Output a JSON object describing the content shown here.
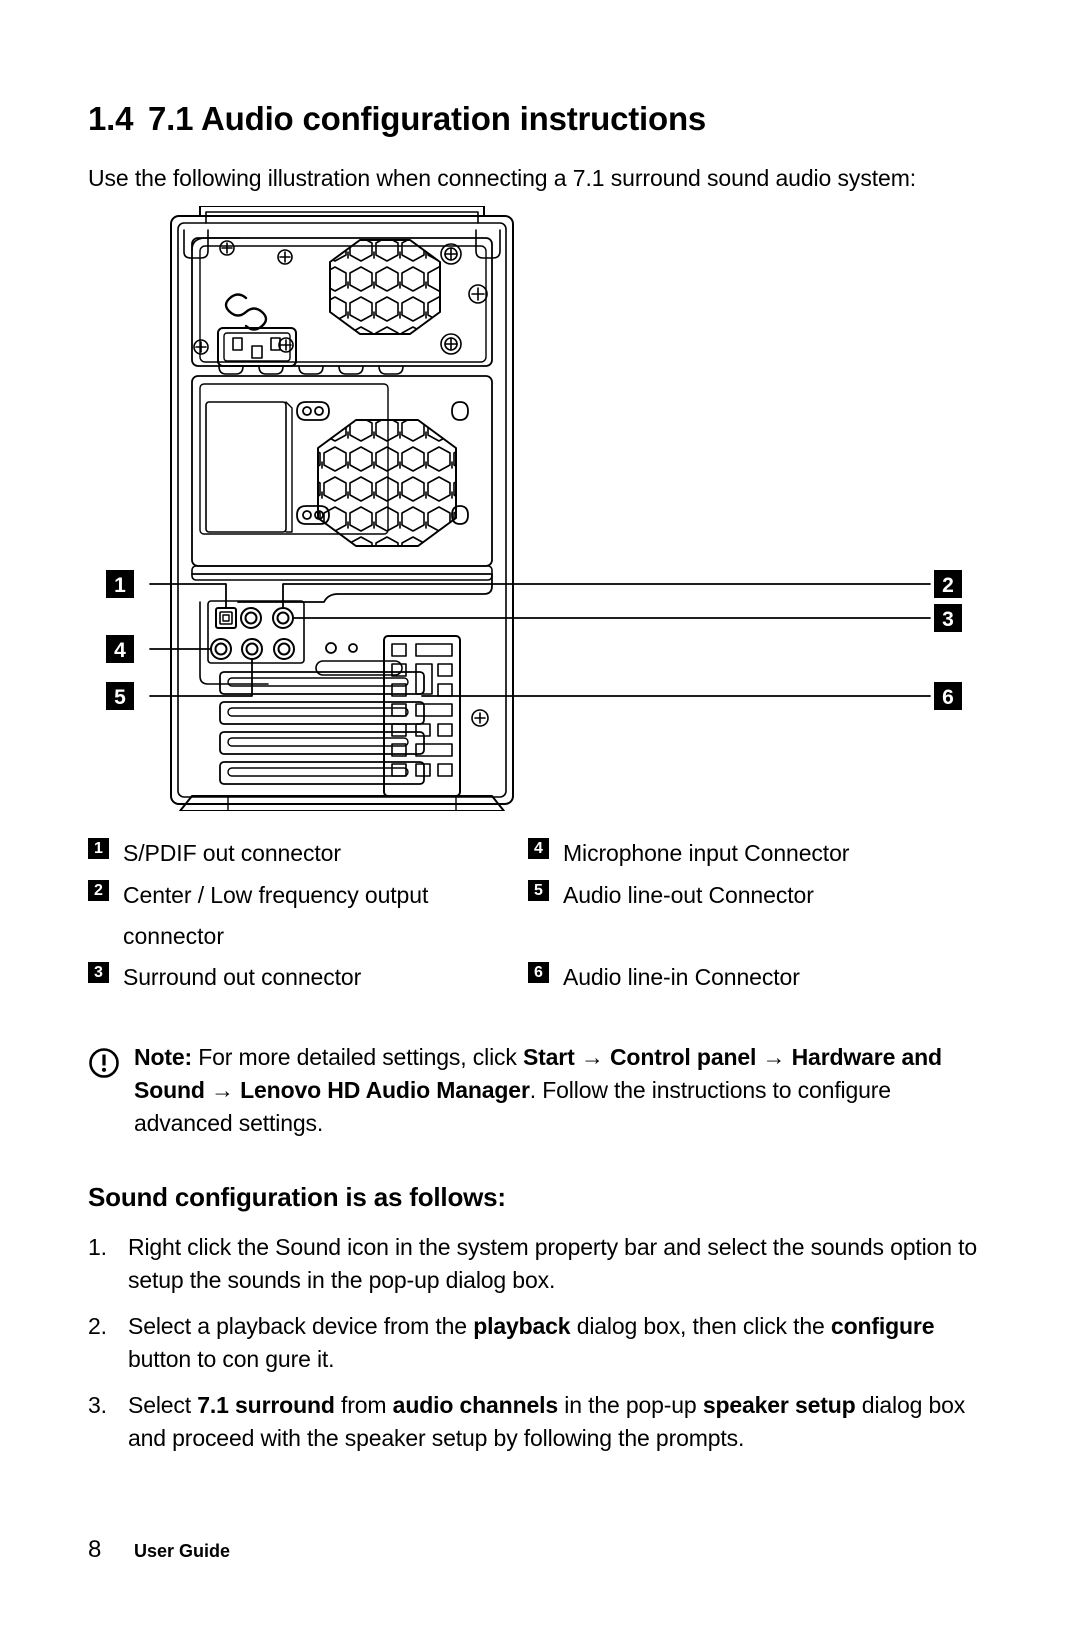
{
  "heading": {
    "number": "1.4",
    "title": "7.1 Audio configuration instructions"
  },
  "intro": "Use the following illustration when connecting a 7.1 surround sound audio system:",
  "figure": {
    "alt_name": "computer-rear-panel-illustration",
    "callouts": [
      "1",
      "2",
      "3",
      "4",
      "5",
      "6"
    ]
  },
  "legend": {
    "left": [
      {
        "number": "1",
        "label": "S/PDIF out connector"
      },
      {
        "number": "2",
        "label": "Center / Low frequency output",
        "continuation": "connector"
      },
      {
        "number": "3",
        "label": "Surround out connector"
      }
    ],
    "right": [
      {
        "number": "4",
        "label": "Microphone input Connector"
      },
      {
        "number": "5",
        "label": "Audio line-out Connector"
      },
      {
        "number": "6",
        "label": "Audio line-in Connector"
      }
    ]
  },
  "note": {
    "icon": "exclamation-circle-icon",
    "label": "Note:",
    "text_1": " For more detailed settings, click ",
    "bold_1": "Start",
    "arrow_1": " → ",
    "bold_2": "Control panel",
    "arrow_2": " → ",
    "bold_3": "Hardware and Sound",
    "arrow_3": " → ",
    "bold_4": "Lenovo HD Audio Manager",
    "text_2": ". Follow the instructions to configure advanced settings."
  },
  "subheading": "Sound configuration is as follows:",
  "steps": [
    {
      "number": "1.",
      "parts": [
        {
          "text": "Right click the Sound icon in the system property bar and select the sounds option to setup the sounds in the pop-up dialog box.",
          "bold": false
        }
      ]
    },
    {
      "number": "2.",
      "parts": [
        {
          "text": "Select a playback device from the ",
          "bold": false
        },
        {
          "text": "playback",
          "bold": true
        },
        {
          "text": " dialog box, then click the ",
          "bold": false
        },
        {
          "text": "configure",
          "bold": true
        },
        {
          "text": " button to con gure it.",
          "bold": false
        }
      ]
    },
    {
      "number": "3.",
      "parts": [
        {
          "text": "Select ",
          "bold": false
        },
        {
          "text": "7.1 surround",
          "bold": true
        },
        {
          "text": " from ",
          "bold": false
        },
        {
          "text": "audio channels",
          "bold": true
        },
        {
          "text": " in the pop-up ",
          "bold": false
        },
        {
          "text": "speaker setup",
          "bold": true
        },
        {
          "text": " dialog box and proceed with the speaker setup by following the prompts.",
          "bold": false
        }
      ]
    }
  ],
  "footer": {
    "page_number": "8",
    "label": "User Guide"
  },
  "colors": {
    "text": "#000000",
    "background": "#ffffff",
    "badge_background": "#000000",
    "badge_text": "#ffffff"
  }
}
